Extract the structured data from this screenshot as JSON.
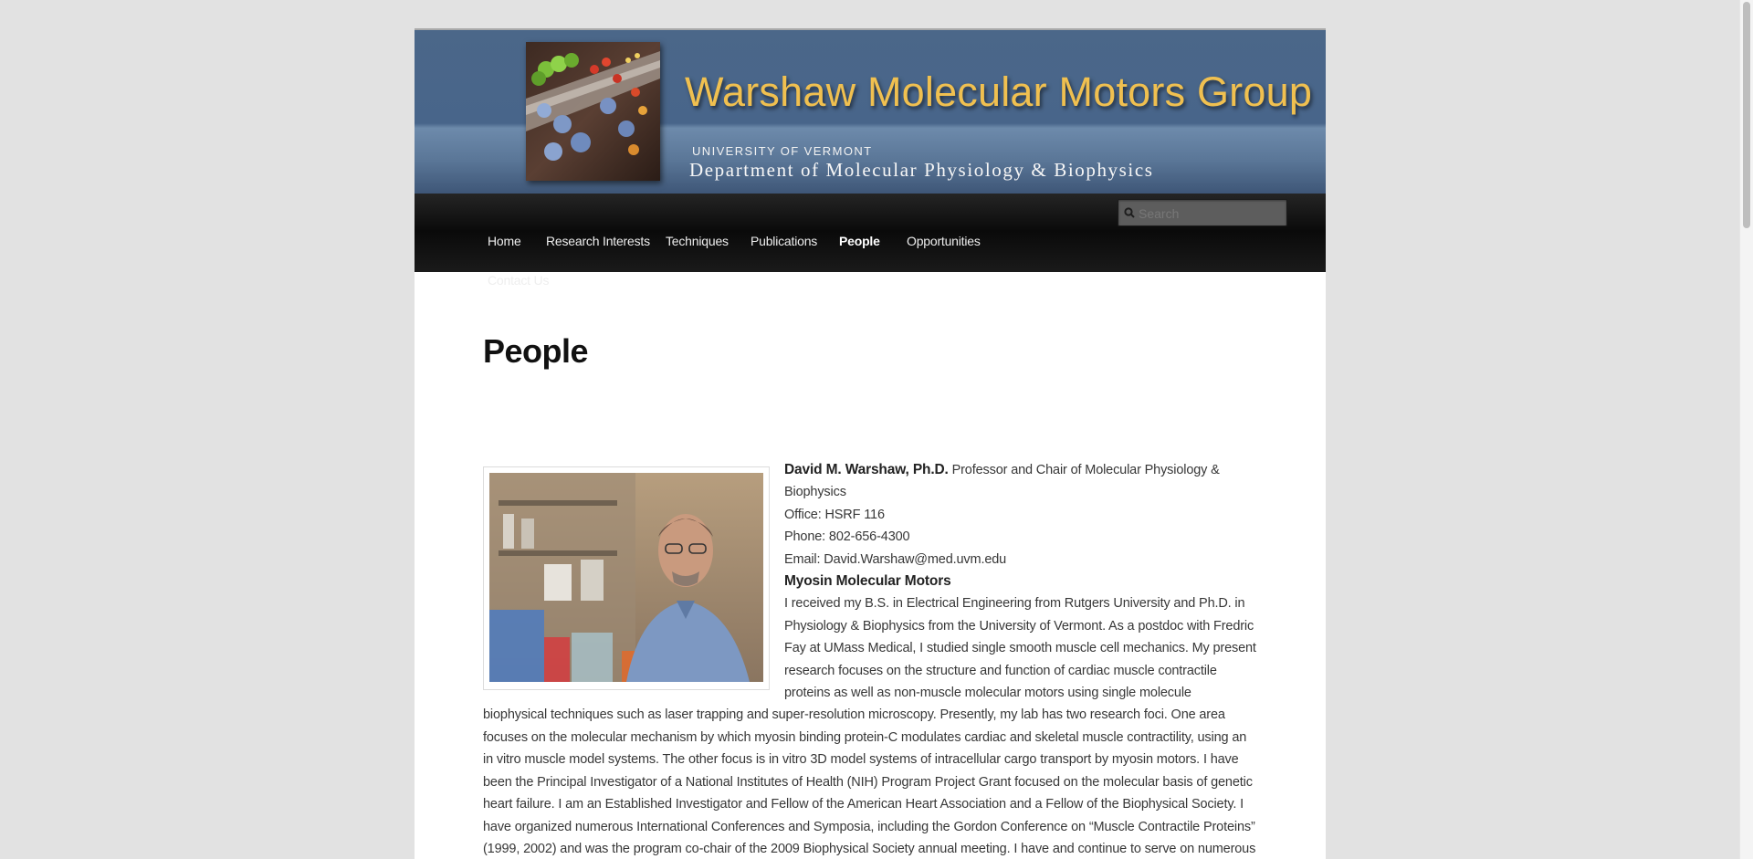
{
  "header": {
    "site_title": "Warshaw Molecular Motors Group",
    "university": "UNIVERSITY OF VERMONT",
    "department": "Department of Molecular Physiology & Biophysics"
  },
  "nav": {
    "items": [
      {
        "label": "Home"
      },
      {
        "label": "Research Interests"
      },
      {
        "label": "Techniques"
      },
      {
        "label": "Publications"
      },
      {
        "label": "People",
        "current": true
      },
      {
        "label": "Opportunities"
      },
      {
        "label": "Contact Us"
      }
    ],
    "search_placeholder": "Search"
  },
  "content": {
    "page_title": "People",
    "person": {
      "name": "David M. Warshaw, Ph.D.",
      "title": "Professor and Chair of Molecular Physiology & Biophysics",
      "office": "Office: HSRF 116",
      "phone": "Phone: 802-656-4300",
      "email": "Email: David.Warshaw@med.uvm.edu",
      "research_heading": "Myosin Molecular Motors",
      "bio": "I received my B.S. in Electrical Engineering from Rutgers University and Ph.D. in Physiology & Biophysics from the University of Vermont. As a postdoc with Fredric Fay at UMass Medical, I studied single smooth muscle cell mechanics. My present research focuses on the structure and function of cardiac muscle contractile proteins as well as non-muscle molecular motors using single molecule biophysical techniques such as laser trapping and super-resolution microscopy. Presently, my lab has two research foci. One area focuses on the molecular mechanism by which myosin binding protein-C modulates cardiac and skeletal muscle contractility, using an in vitro muscle model systems. The other focus is in vitro 3D model systems of intracellular cargo transport by myosin motors. I have been the Principal Investigator of a National Institutes of Health (NIH) Program Project Grant focused on the molecular basis of genetic heart failure. I am an Established Investigator and Fellow of the American Heart Association and a Fellow of the Biophysical Society. I have organized numerous International Conferences and Symposia, including the Gordon Conference on “Muscle Contractile Proteins” (1999, 2002) and was the program co-chair of the 2009 Biophysical Society annual meeting. I have and continue to serve on numerous NIH review"
    }
  }
}
